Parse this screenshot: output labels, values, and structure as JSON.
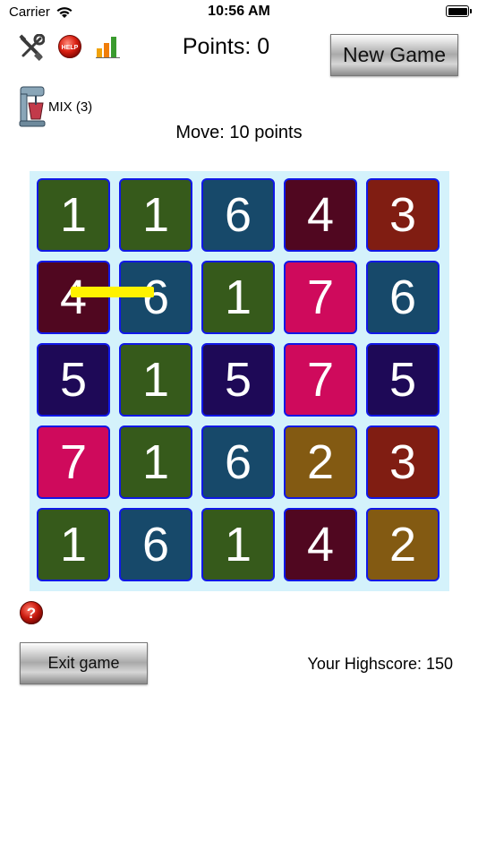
{
  "status_bar": {
    "carrier": "Carrier",
    "time": "10:56 AM"
  },
  "toolbar": {
    "settings_icon": "tools-icon",
    "help_icon": "help-button-icon",
    "stats_icon": "bar-chart-icon",
    "help_text": "HELP"
  },
  "score": {
    "points_label": "Points: 0"
  },
  "buttons": {
    "new_game": "New Game",
    "exit_game": "Exit game"
  },
  "mix": {
    "label": "MIX (3)"
  },
  "move": {
    "label": "Move: 10 points"
  },
  "colors": {
    "1": "#365a1b",
    "2": "#835a12",
    "3": "#801d12",
    "4": "#500720",
    "5": "#1e0957",
    "6": "#17496a",
    "7": "#cf0a5c"
  },
  "board": {
    "grid": [
      [
        1,
        1,
        6,
        4,
        3
      ],
      [
        4,
        6,
        1,
        7,
        6
      ],
      [
        5,
        1,
        5,
        7,
        5
      ],
      [
        7,
        1,
        6,
        2,
        3
      ],
      [
        1,
        6,
        1,
        4,
        2
      ]
    ]
  },
  "footer": {
    "highscore": "Your Highscore: 150"
  }
}
